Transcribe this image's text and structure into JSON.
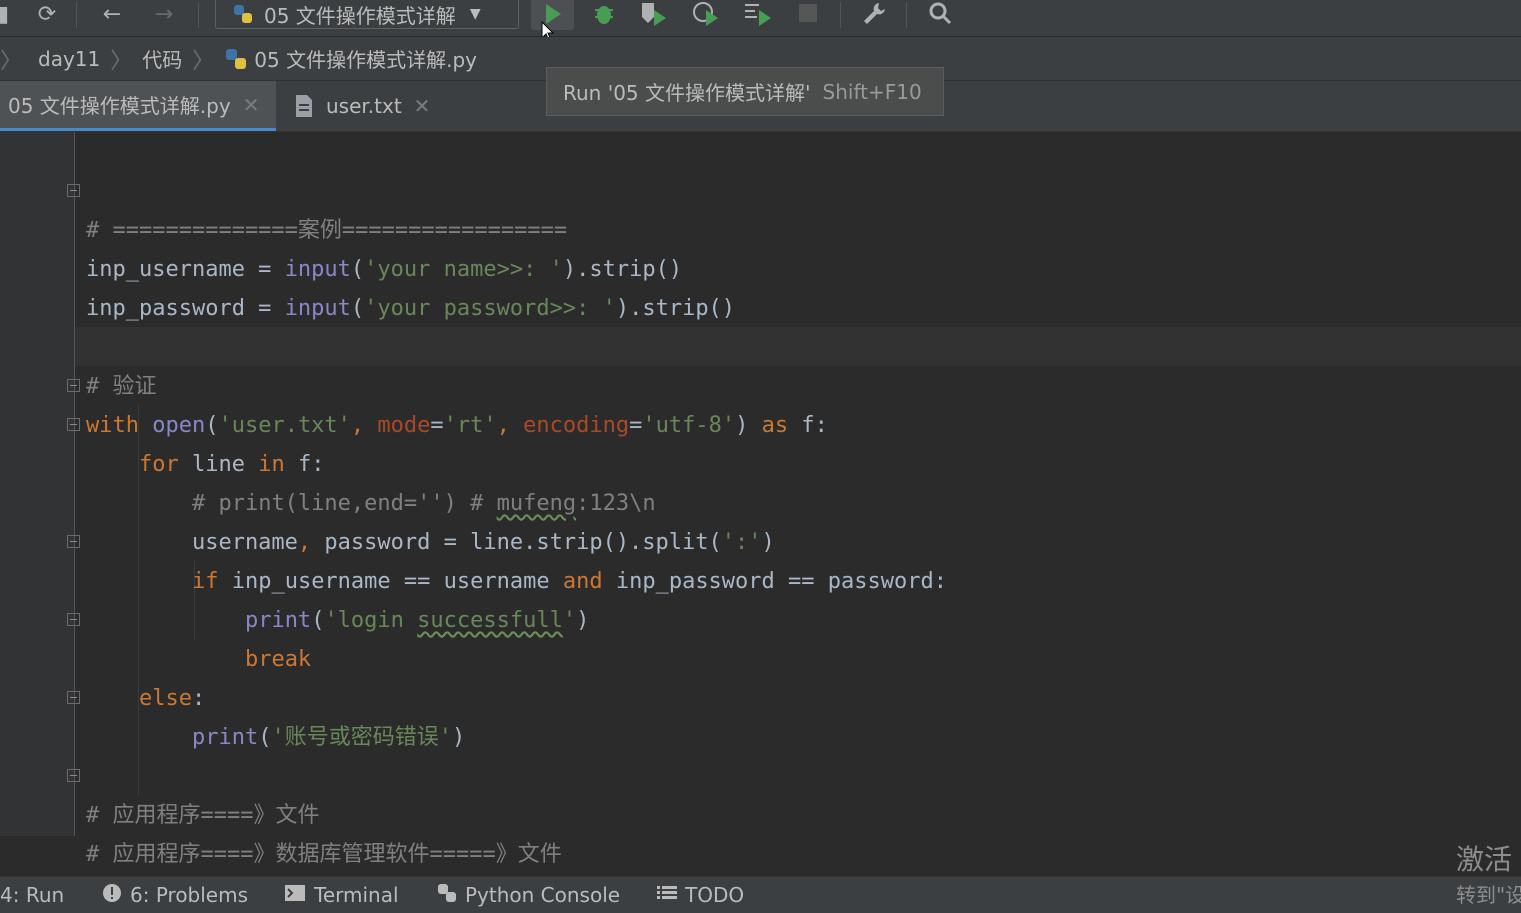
{
  "toolbar": {
    "run_config_label": "05 文件操作模式详解",
    "colors": {
      "run": "#499c54",
      "debug": "#499c54"
    }
  },
  "breadcrumb": {
    "items": [
      "day11",
      "代码",
      "05 文件操作模式详解.py"
    ]
  },
  "tooltip": {
    "text": "Run '05 文件操作模式详解'",
    "shortcut": "Shift+F10"
  },
  "tabs": [
    {
      "label": "05 文件操作模式详解.py",
      "active": true,
      "close": "✕"
    },
    {
      "label": "user.txt",
      "active": false,
      "close": "✕"
    }
  ],
  "code": {
    "lines": [
      {
        "id": "l1",
        "text": ""
      },
      {
        "id": "l2",
        "tokens": [
          [
            "cm",
            "# ==============案例================="
          ]
        ]
      },
      {
        "id": "l3",
        "tokens": [
          [
            "id",
            "inp_username = "
          ],
          [
            "bi",
            "input"
          ],
          [
            "id",
            "("
          ],
          [
            "str",
            "'your name>>: '"
          ],
          [
            "id",
            ").strip()"
          ]
        ]
      },
      {
        "id": "l4",
        "tokens": [
          [
            "id",
            "inp_password = "
          ],
          [
            "bi",
            "input"
          ],
          [
            "id",
            "("
          ],
          [
            "str",
            "'your password>>: '"
          ],
          [
            "id",
            ").strip()"
          ]
        ]
      },
      {
        "id": "l5",
        "text": ""
      },
      {
        "id": "l6",
        "tokens": [
          [
            "cm",
            "# 验证"
          ]
        ]
      },
      {
        "id": "l7",
        "tokens": [
          [
            "kw",
            "with "
          ],
          [
            "bi",
            "open"
          ],
          [
            "id",
            "("
          ],
          [
            "str",
            "'user.txt'"
          ],
          [
            "kw",
            ", "
          ],
          [
            "pr",
            "mode"
          ],
          [
            "id",
            "="
          ],
          [
            "str",
            "'rt'"
          ],
          [
            "kw",
            ", "
          ],
          [
            "pr",
            "encoding"
          ],
          [
            "id",
            "="
          ],
          [
            "str",
            "'utf-8'"
          ],
          [
            "id",
            ") "
          ],
          [
            "kw",
            "as "
          ],
          [
            "id",
            "f:"
          ]
        ]
      },
      {
        "id": "l8",
        "tokens": [
          [
            "id",
            "    "
          ],
          [
            "kw",
            "for "
          ],
          [
            "id",
            "line "
          ],
          [
            "kw",
            "in "
          ],
          [
            "id",
            "f:"
          ]
        ]
      },
      {
        "id": "l9",
        "tokens": [
          [
            "id",
            "        "
          ],
          [
            "cm",
            "# print(line,end='') # "
          ],
          [
            "cmsq",
            "mufeng"
          ],
          [
            "cm",
            ":123\\n"
          ]
        ]
      },
      {
        "id": "l10",
        "tokens": [
          [
            "id",
            "        username"
          ],
          [
            "kw",
            ", "
          ],
          [
            "id",
            "password = line.strip().split("
          ],
          [
            "str",
            "':'"
          ],
          [
            "id",
            ")"
          ]
        ]
      },
      {
        "id": "l11",
        "tokens": [
          [
            "id",
            "        "
          ],
          [
            "kw",
            "if "
          ],
          [
            "id",
            "inp_username == username "
          ],
          [
            "kw",
            "and "
          ],
          [
            "id",
            "inp_password == password:"
          ]
        ]
      },
      {
        "id": "l12",
        "tokens": [
          [
            "id",
            "            "
          ],
          [
            "bi",
            "print"
          ],
          [
            "id",
            "("
          ],
          [
            "str",
            "'login "
          ],
          [
            "strsq",
            "successfull"
          ],
          [
            "str",
            "'"
          ],
          [
            "id",
            ")"
          ]
        ]
      },
      {
        "id": "l13",
        "tokens": [
          [
            "id",
            "            "
          ],
          [
            "kw",
            "break"
          ]
        ]
      },
      {
        "id": "l14",
        "tokens": [
          [
            "id",
            "    "
          ],
          [
            "kw",
            "else"
          ],
          [
            "id",
            ":"
          ]
        ]
      },
      {
        "id": "l15",
        "tokens": [
          [
            "id",
            "        "
          ],
          [
            "bi",
            "print"
          ],
          [
            "id",
            "("
          ],
          [
            "str",
            "'账号或密码错误'"
          ],
          [
            "id",
            ")"
          ]
        ]
      },
      {
        "id": "l16",
        "text": ""
      },
      {
        "id": "l17",
        "tokens": [
          [
            "cm",
            "# 应用程序====》文件"
          ]
        ]
      },
      {
        "id": "l18",
        "tokens": [
          [
            "cm",
            "# 应用程序====》数据库管理软件=====》文件"
          ]
        ]
      }
    ]
  },
  "bottom_bar": {
    "items": [
      {
        "label": "4: Run",
        "icon": "none"
      },
      {
        "label": "6: Problems",
        "icon": "problems-icon"
      },
      {
        "label": "Terminal",
        "icon": "terminal-icon"
      },
      {
        "label": "Python Console",
        "icon": "python-icon"
      },
      {
        "label": "TODO",
        "icon": "list-icon"
      }
    ]
  },
  "watermark": {
    "line1": "激活",
    "line2": "转到\"设"
  }
}
